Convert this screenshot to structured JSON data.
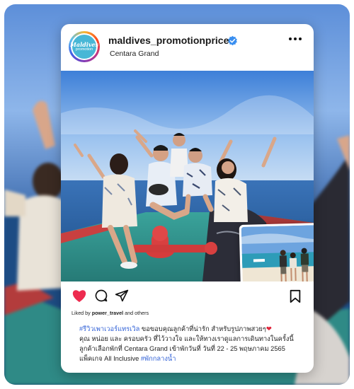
{
  "post": {
    "username": "maldives_promotionprice",
    "location": "Centara Grand",
    "avatar_text_line1": "Maldives",
    "avatar_text_line2": "promotion",
    "verified_icon": "verified-badge-icon",
    "more_icon": "more-options-icon",
    "liked_by_prefix": "Liked by ",
    "liked_by_user": "power_travel",
    "liked_by_suffix": " and others",
    "caption": {
      "hashtag1": "#รีวิวเพาเวอร์แทรเวิล",
      "text1": " ขอขอบคุณลูกค้าที่น่ารัก สำหรับรูปภาพสวยๆ",
      "heart": "❤",
      "text2": "คุณ หน่อย และ ครอบครัว ที่ไว้วางใจ และให้ทางเราดูแลการเดินทางในครั้งนี้ ลูกค้าเลือกพักที่ Centara Grand เข้าพักวันที่ วันที่ 22 - 25 พฤษภาคม 2565 แพ็คเกจ All Inclusive ",
      "hashtag2": "#พักกลางน้ำ"
    }
  },
  "icons": {
    "like": "heart-icon",
    "comment": "comment-icon",
    "share": "paper-plane-icon",
    "save": "bookmark-icon"
  },
  "colors": {
    "like_red": "#ed2b4f",
    "hashtag_blue": "#2e5fd6",
    "verified_blue": "#3a8ff0"
  }
}
